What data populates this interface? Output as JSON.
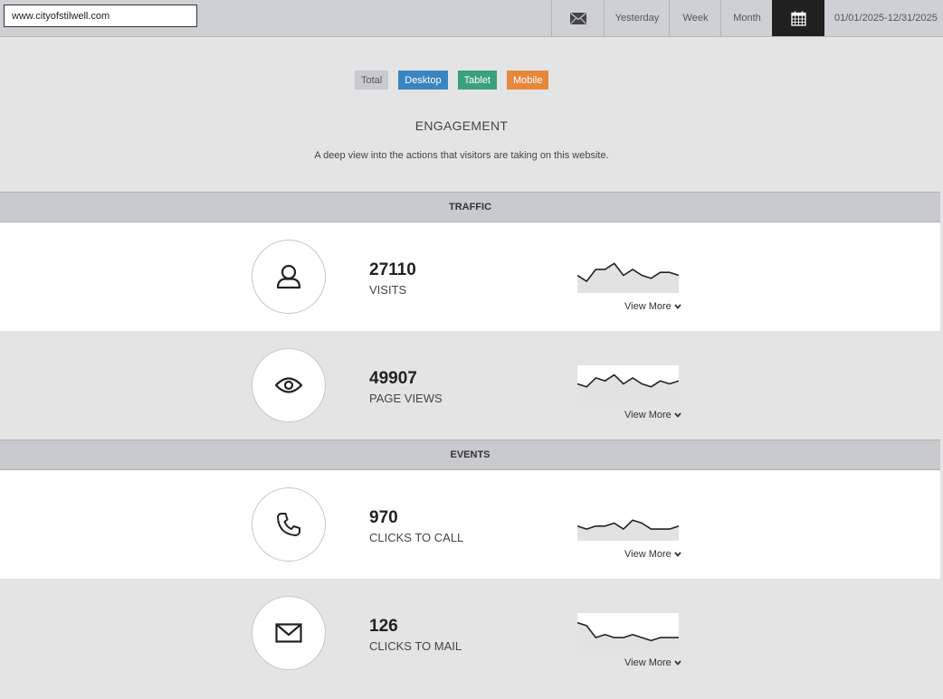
{
  "topbar": {
    "url": "www.cityofstilwell.com",
    "mail_icon": "envelope-icon",
    "yesterday": "Yesterday",
    "week": "Week",
    "month": "Month",
    "calendar_icon": "calendar-icon",
    "date_range": "01/01/2025-12/31/2025"
  },
  "filters": {
    "total": "Total",
    "desktop": "Desktop",
    "tablet": "Tablet",
    "mobile": "Mobile",
    "colors": {
      "total": "#c9cacd",
      "desktop": "#3a84c0",
      "tablet": "#3ba07c",
      "mobile": "#e5883b"
    }
  },
  "page": {
    "title": "ENGAGEMENT",
    "subtitle": "A deep view into the actions that visitors are taking on this website."
  },
  "sections": {
    "traffic": "TRAFFIC",
    "events": "EVENTS"
  },
  "metrics": {
    "visits": {
      "icon": "user-icon",
      "value": "27110",
      "label": "VISITS",
      "view_more": "View More",
      "trend": [
        5,
        3,
        7,
        7,
        9,
        5,
        7,
        5,
        4,
        6,
        6,
        5
      ]
    },
    "page_views": {
      "icon": "eye-icon",
      "value": "49907",
      "label": "PAGE VIEWS",
      "view_more": "View More",
      "trend": [
        5,
        4,
        7,
        6,
        8,
        5,
        7,
        5,
        4,
        6,
        5,
        6
      ]
    },
    "clicks_to_call": {
      "icon": "phone-icon",
      "value": "970",
      "label": "CLICKS TO CALL",
      "view_more": "View More",
      "trend": [
        4,
        3,
        4,
        4,
        5,
        3,
        6,
        5,
        3,
        3,
        3,
        4
      ]
    },
    "clicks_to_mail": {
      "icon": "envelope-icon",
      "value": "126",
      "label": "CLICKS TO MAIL",
      "view_more": "View More",
      "trend": [
        8,
        7,
        3,
        4,
        3,
        3,
        4,
        3,
        2,
        3,
        3,
        3
      ]
    }
  }
}
